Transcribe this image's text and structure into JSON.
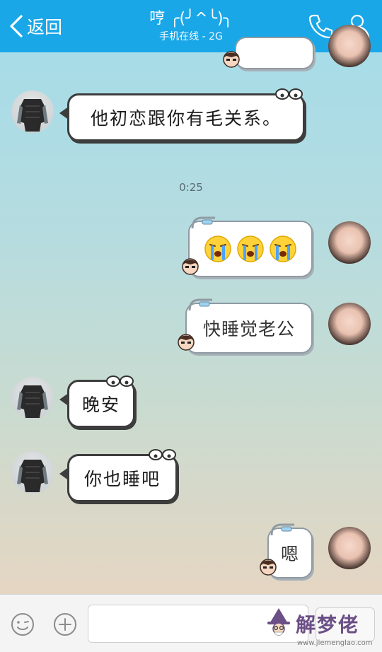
{
  "header": {
    "back_label": "返回",
    "title": "哼 ╭(╯^╰)╮",
    "subtitle": "手机在线 - 2G",
    "bg_color": "#1aa7e8"
  },
  "messages": [
    {
      "side": "left",
      "text": "他初恋跟你有毛关系。"
    },
    {
      "side": "right",
      "emoji": [
        "crying-face-icon",
        "crying-face-icon",
        "crying-face-icon"
      ]
    },
    {
      "side": "right",
      "text": "快睡觉老公"
    },
    {
      "side": "left",
      "text": "晚安"
    },
    {
      "side": "left",
      "text": "你也睡吧"
    },
    {
      "side": "right",
      "text": "嗯"
    }
  ],
  "timestamp": "0:25",
  "input": {
    "value": "",
    "placeholder": ""
  },
  "watermark": {
    "text": "解梦佬",
    "url": "www.jiemenglao.com"
  }
}
